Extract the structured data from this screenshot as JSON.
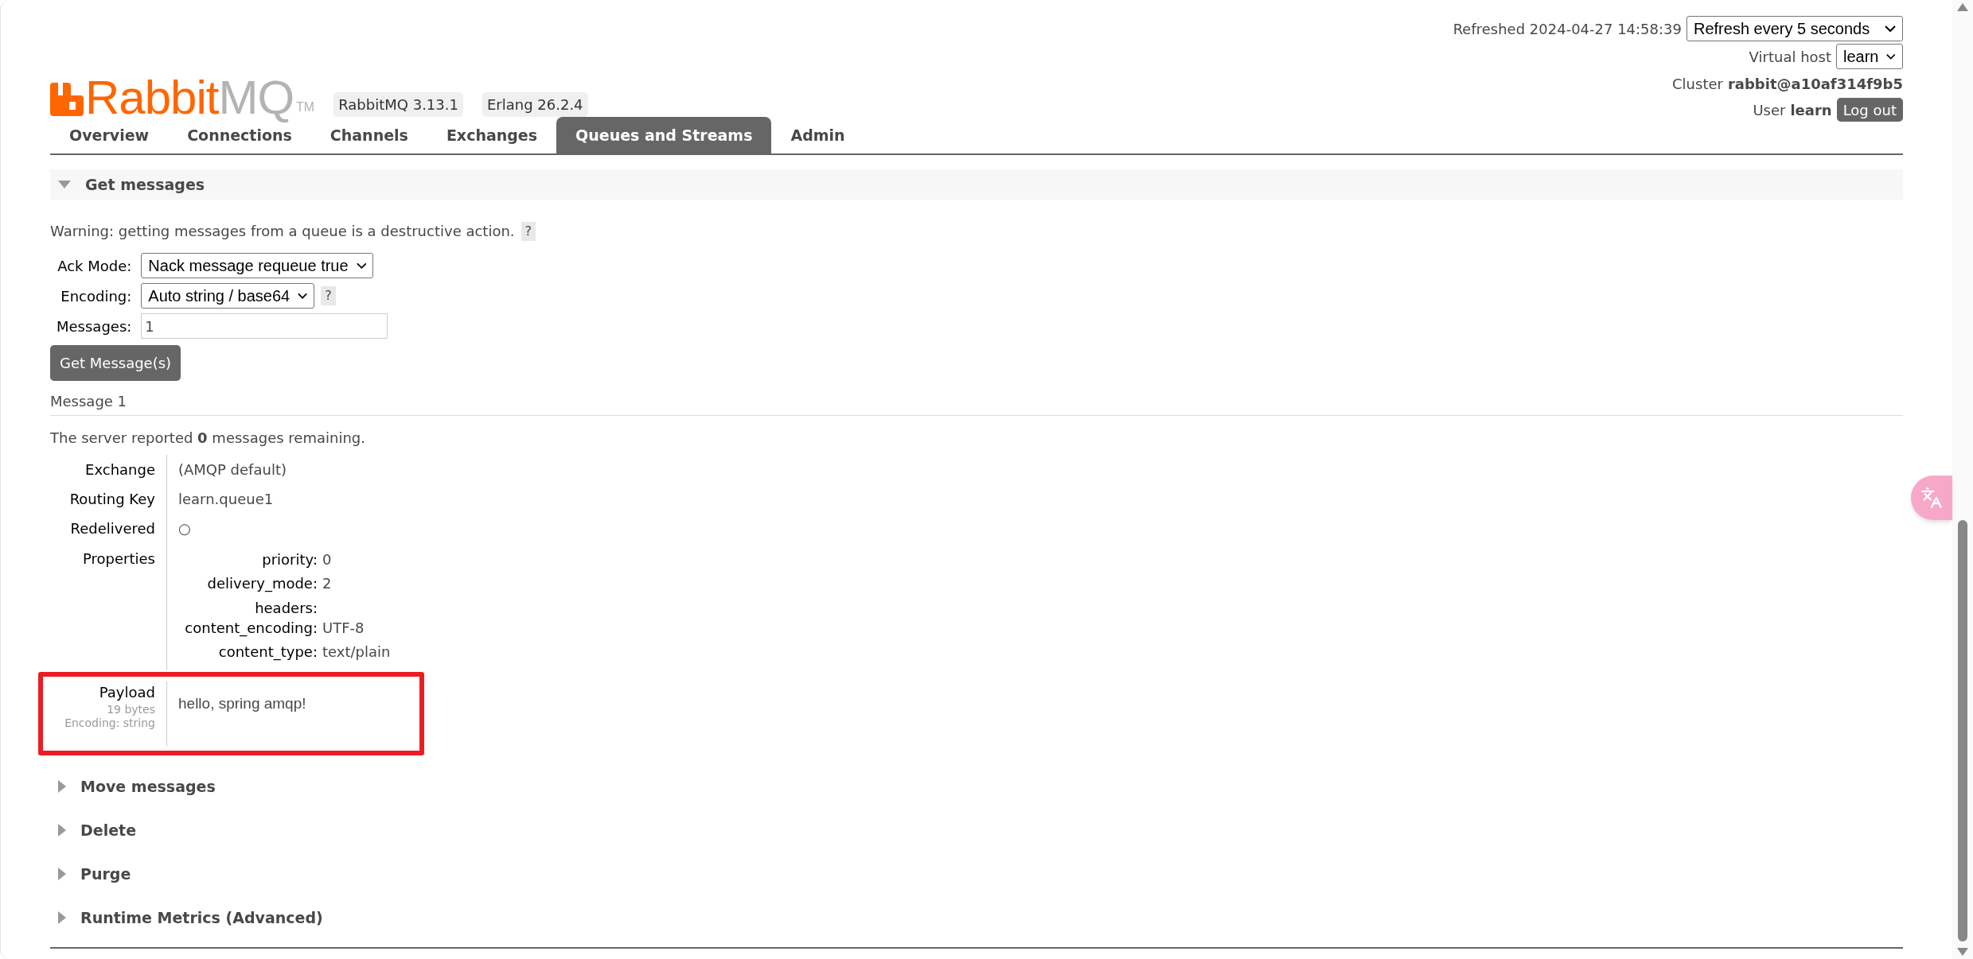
{
  "logo": {
    "part_a": "Rabbit",
    "part_b": "MQ",
    "mark": "TM"
  },
  "versions": [
    "RabbitMQ 3.13.1",
    "Erlang 26.2.4"
  ],
  "header": {
    "refreshed": "Refreshed 2024-04-27 14:58:39",
    "refresh_select": "Refresh every 5 seconds",
    "vhost_label": "Virtual host",
    "vhost_select": "learn",
    "cluster_label": "Cluster",
    "cluster": "rabbit@a10af314f9b5",
    "user_label": "User",
    "user": "learn",
    "logout": "Log out"
  },
  "tabs": [
    {
      "label": "Overview",
      "selected": false
    },
    {
      "label": "Connections",
      "selected": false
    },
    {
      "label": "Channels",
      "selected": false
    },
    {
      "label": "Exchanges",
      "selected": false
    },
    {
      "label": "Queues and Streams",
      "selected": true
    },
    {
      "label": "Admin",
      "selected": false
    }
  ],
  "get_messages": {
    "title": "Get messages",
    "expanded": true,
    "warning": "Warning: getting messages from a queue is a destructive action.",
    "help": "?",
    "ack_mode": {
      "label": "Ack Mode:",
      "value": "Nack message requeue true"
    },
    "encoding": {
      "label": "Encoding:",
      "value": "Auto string / base64",
      "help": "?"
    },
    "messages": {
      "label": "Messages:",
      "value": "1"
    },
    "button": "Get Message(s)"
  },
  "message": {
    "title": "Message 1",
    "remaining": "The server reported **0** messages remaining.",
    "fields": [
      {
        "label": "Exchange",
        "value": "(AMQP default)"
      },
      {
        "label": "Routing Key",
        "value": "learn.queue1"
      },
      {
        "label": "Redelivered",
        "value": "○"
      }
    ],
    "properties_label": "Properties",
    "properties": [
      {
        "key": "priority:",
        "value": "0"
      },
      {
        "key": "delivery_mode:",
        "value": "2"
      },
      {
        "key": "headers:"
      },
      {
        "key": "content_encoding:",
        "value": "UTF-8"
      },
      {
        "key": "content_type:",
        "value": "text/plain"
      }
    ],
    "payload": {
      "label": "Payload",
      "size": "19 bytes",
      "encoding": "Encoding: string",
      "value": "hello, spring amqp!",
      "highlighted": true
    }
  },
  "sections": [
    {
      "title": "Move messages",
      "expanded": false
    },
    {
      "title": "Delete",
      "expanded": false
    },
    {
      "title": "Purge",
      "expanded": false
    },
    {
      "title": "Runtime Metrics (Advanced)",
      "expanded": false
    }
  ]
}
